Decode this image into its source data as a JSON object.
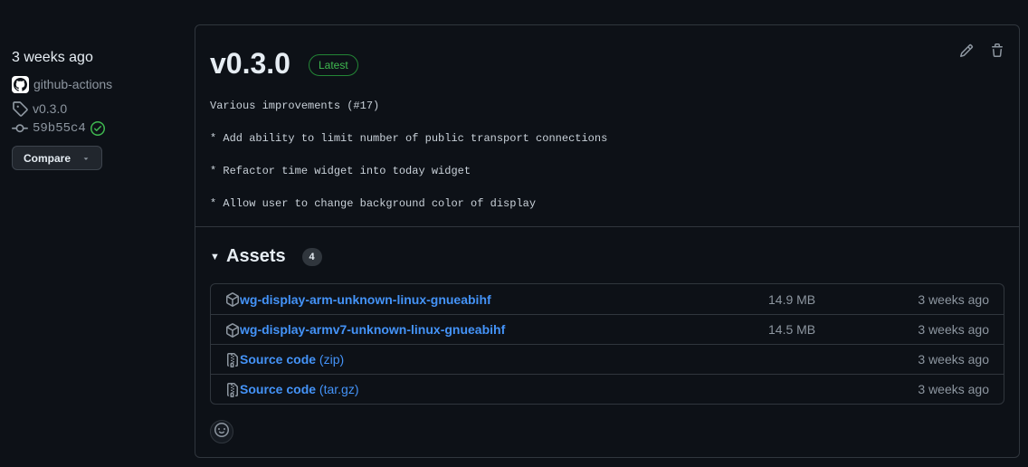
{
  "sidebar": {
    "time_ago": "3 weeks ago",
    "author": "github-actions",
    "tag": "v0.3.0",
    "commit": "59b55c4",
    "compare_label": "Compare"
  },
  "release": {
    "version": "v0.3.0",
    "badge": "Latest",
    "notes": [
      "Various improvements (#17)",
      "* Add ability to limit number of public transport connections",
      "* Refactor time widget into today widget",
      "* Allow user to change background color of display"
    ]
  },
  "assets": {
    "title": "Assets",
    "count": "4",
    "items": [
      {
        "name": "wg-display-arm-unknown-linux-gnueabihf",
        "suffix": "",
        "size": "14.9 MB",
        "date": "3 weeks ago",
        "icon": "package-icon"
      },
      {
        "name": "wg-display-armv7-unknown-linux-gnueabihf",
        "suffix": "",
        "size": "14.5 MB",
        "date": "3 weeks ago",
        "icon": "package-icon"
      },
      {
        "name": "Source code",
        "suffix": "(zip)",
        "size": "",
        "date": "3 weeks ago",
        "icon": "file-zip-icon"
      },
      {
        "name": "Source code",
        "suffix": "(tar.gz)",
        "size": "",
        "date": "3 weeks ago",
        "icon": "file-zip-icon"
      }
    ]
  },
  "colors": {
    "background": "#0d1117",
    "border": "#30363d",
    "link": "#4493f8",
    "success": "#3fb950",
    "muted": "#8d96a0"
  }
}
